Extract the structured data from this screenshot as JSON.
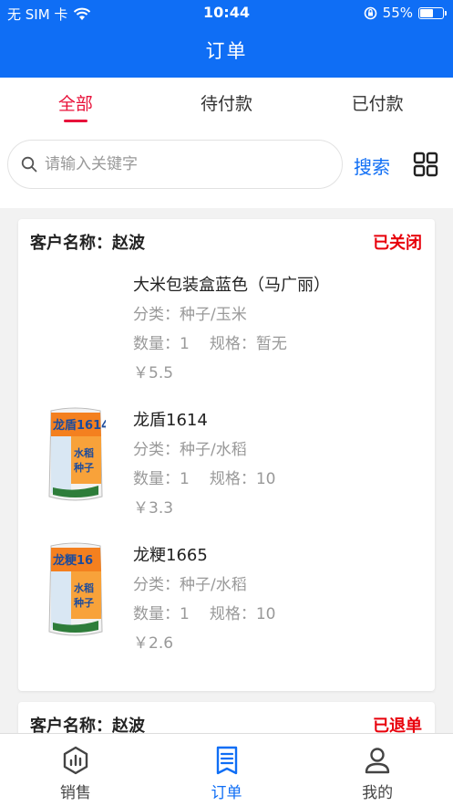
{
  "status_bar": {
    "carrier": "无 SIM 卡",
    "time": "10:44",
    "battery": "55%",
    "battery_level": 0.55
  },
  "header": {
    "title": "订单"
  },
  "tabs": [
    {
      "label": "全部",
      "active": true
    },
    {
      "label": "待付款",
      "active": false
    },
    {
      "label": "已付款",
      "active": false
    }
  ],
  "search": {
    "placeholder": "请输入关键字",
    "button_label": "搜索"
  },
  "orders": [
    {
      "customer": "客户名称：赵波",
      "status": "已关闭",
      "items": [
        {
          "name": "大米包装盒蓝色（马广丽）",
          "category": "分类：种子/玉米",
          "quantity": "数量：1",
          "spec": "规格：暂无",
          "price": "￥5.5",
          "has_image": false
        },
        {
          "name": "龙盾1614",
          "category": "分类：种子/水稻",
          "quantity": "数量：1",
          "spec": "规格：10",
          "price": "￥3.3",
          "has_image": true,
          "image_text": "龙盾1614"
        },
        {
          "name": "龙粳1665",
          "category": "分类：种子/水稻",
          "quantity": "数量：1",
          "spec": "规格：10",
          "price": "￥2.6",
          "has_image": true,
          "image_text": "龙粳16"
        }
      ]
    },
    {
      "customer": "客户名称：赵波",
      "status": "已退单",
      "items": []
    }
  ],
  "bottom_nav": [
    {
      "label": "销售",
      "icon": "sales-chart-icon",
      "active": false
    },
    {
      "label": "订单",
      "icon": "order-list-icon",
      "active": true
    },
    {
      "label": "我的",
      "icon": "user-icon",
      "active": false
    }
  ],
  "colors": {
    "primary": "#0f6ef5",
    "active_tab": "#e8123a",
    "status_red": "#e8000b"
  }
}
